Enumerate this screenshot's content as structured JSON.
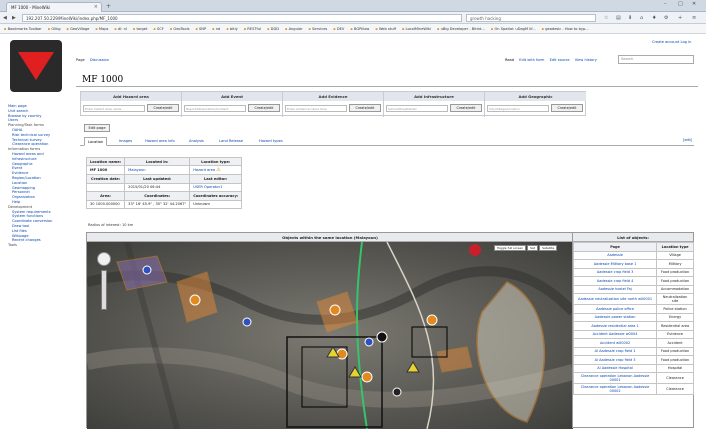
{
  "browser": {
    "tab_title": "MF 1000 - MineWiki",
    "url": "192.207.50.229/MineWiki/index.php/MF_1000",
    "search_text": "growth hacking",
    "bookmarks": [
      "Bookmarks Toolbar",
      "Gilkg",
      "GeoVillage",
      "Maps",
      "dl: nl",
      "target",
      "SCF",
      "GeoTools",
      "SNP",
      "nd",
      "bitly",
      "RESTful",
      "DDD",
      "Angular",
      "Services",
      "DEV",
      "BGPillow",
      "Web stuff",
      "LocalMineWiki",
      "uBlg Developer - Bitrid...",
      "On Spatial: uDagM lif...",
      "geodesic - How to byp..."
    ]
  },
  "wiki": {
    "user_links": "Create account  Log in",
    "page_tabs": [
      "Page",
      "Discussion"
    ],
    "view_tabs": [
      "Read",
      "Edit with form",
      "Edit source",
      "View history"
    ],
    "search_placeholder": "Search",
    "title": "MF 1000",
    "edit_page_label": "Edit page",
    "edit_link": "[edit]",
    "sidebar": {
      "links": [
        "Main page",
        "Unit search",
        "Browse by country",
        "Users"
      ],
      "planning_header": "Planning/Task forms",
      "planning_items": [
        "OAHA",
        "Risk technical survey",
        "Technical survey",
        "Clearance operation"
      ],
      "info_header": "Information forms",
      "info_items": [
        "Hazard areas and infrastructure",
        "Geographic",
        "Event",
        "Evidence",
        "Region/Location",
        "Location",
        "Geomapping",
        "Personnel",
        "Organization",
        "Help"
      ],
      "dev_header": "Development",
      "dev_items": [
        "System requirements",
        "System functions",
        "Coordinate conversion",
        "Draw tool",
        "List files",
        "Wikipage",
        "Recent changes"
      ],
      "tools_header": "Tools"
    },
    "forms": [
      {
        "title": "Add Hazard area",
        "placeholder": "Enter hazard area name",
        "button": "Create/edit"
      },
      {
        "title": "Add Event",
        "placeholder": "Report/Observation/Incident",
        "button": "Create/edit"
      },
      {
        "title": "Add Evidence",
        "placeholder": "Enter evidence name here",
        "button": "Create/edit"
      },
      {
        "title": "Add Infrastructure",
        "placeholder": "School/Hospital/etc",
        "button": "Create/edit"
      },
      {
        "title": "Add Geographic",
        "placeholder": "City/Village/Location",
        "button": "Create/edit"
      }
    ],
    "content_tabs": [
      "Location",
      "Images",
      "Hazard area info",
      "Analysis",
      "Land Release",
      "Hazard types"
    ],
    "info_table": {
      "r1": [
        "Location name:",
        "Located in:",
        "Location type:"
      ],
      "r2": [
        "MF 1000",
        "Malayoun",
        "Hazard area"
      ],
      "r3": [
        "Creation date:",
        "Last updated:",
        "Last editor:"
      ],
      "r4": [
        "",
        "2015/01/20 06:44",
        "USER Operator1"
      ],
      "r5": [
        "Area:",
        "Coordinates:",
        "Coordinates accuracy:"
      ],
      "r6": [
        "30 1000.000000",
        "33° 16' 45.9\" , 35° 32' 44.2067\"",
        "Unknown"
      ]
    },
    "radius_label": "Radius of interest: 10 km",
    "map_title": "Objects within the same location (Malayoun)",
    "map_toggles": [
      "Toggle full screen",
      "Sat",
      "Satellite"
    ],
    "objects": {
      "title": "List of objects:",
      "headers": [
        "Page",
        "Location type"
      ],
      "rows": [
        [
          "Aadessie",
          "Village"
        ],
        [
          "Aadessie Military base 1",
          "Military"
        ],
        [
          "Aadessie crop field 3",
          "Food production"
        ],
        [
          "Aadessie crop field 4",
          "Food production"
        ],
        [
          "Aadessie hostel Faj",
          "Accommodation"
        ],
        [
          "Aadessie neutralization site north w00001",
          "Neutralization site"
        ],
        [
          "Aadessie police office",
          "Police station"
        ],
        [
          "Aadessie power station",
          "Energy"
        ],
        [
          "Aadessie residential area 1",
          "Residential area"
        ],
        [
          "Accident Aadessie w0004",
          "Evidence"
        ],
        [
          "Accident w00002",
          "Accident"
        ],
        [
          "Al Aadessie crop field 1",
          "Food production"
        ],
        [
          "Al Aadessie crop field 3",
          "Food production"
        ],
        [
          "Al Aadessie Hospital",
          "Hospital"
        ],
        [
          "Clearance operation Lebanon Aadessie 00001",
          "Clearance"
        ],
        [
          "Clearance operation Lebanon Aadessie 00002",
          "Clearance"
        ]
      ]
    }
  }
}
